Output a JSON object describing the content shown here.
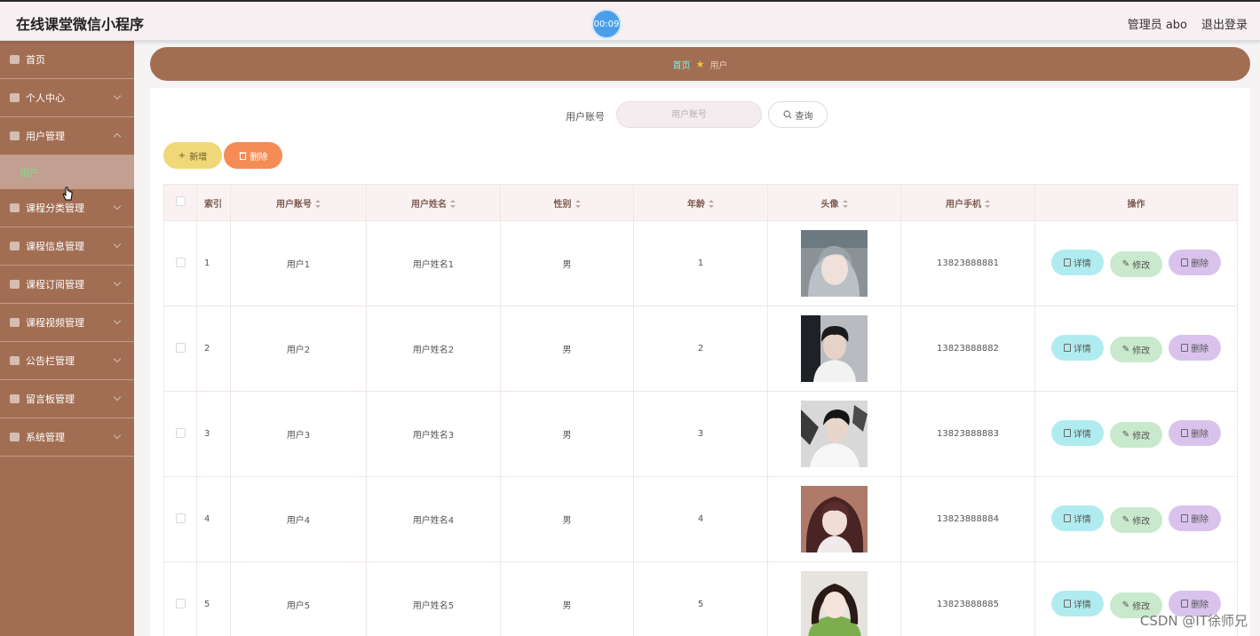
{
  "header": {
    "title": "在线课堂微信小程序",
    "timer": "00:09",
    "admin": "管理员 abo",
    "logout": "退出登录"
  },
  "sidebar": {
    "items": [
      {
        "label": "首页",
        "icon": "home-icon",
        "has_chevron": false
      },
      {
        "label": "个人中心",
        "icon": "user-icon",
        "has_chevron": true
      },
      {
        "label": "用户管理",
        "icon": "list-icon",
        "has_chevron": true,
        "expanded": true
      },
      {
        "label": "课程分类管理",
        "icon": "list-icon",
        "has_chevron": true
      },
      {
        "label": "课程信息管理",
        "icon": "folder-icon",
        "has_chevron": true
      },
      {
        "label": "课程订阅管理",
        "icon": "frame-icon",
        "has_chevron": true
      },
      {
        "label": "课程视频管理",
        "icon": "gear-icon",
        "has_chevron": true
      },
      {
        "label": "公告栏管理",
        "icon": "menu-icon",
        "has_chevron": true
      },
      {
        "label": "留言板管理",
        "icon": "frame-icon",
        "has_chevron": true
      },
      {
        "label": "系统管理",
        "icon": "settings-icon",
        "has_chevron": true
      }
    ],
    "submenu_label": "用户"
  },
  "breadcrumb": {
    "home": "首页",
    "current": "用户"
  },
  "search": {
    "label": "用户账号",
    "placeholder": "用户账号",
    "button": "查询"
  },
  "toolbar": {
    "add": "新增",
    "delete": "删除"
  },
  "table": {
    "headers": [
      "索引",
      "用户账号",
      "用户姓名",
      "性别",
      "年龄",
      "头像",
      "用户手机",
      "操作"
    ],
    "rows": [
      {
        "index": "1",
        "account": "用户1",
        "name": "用户姓名1",
        "gender": "男",
        "age": "1",
        "phone": "13823888881"
      },
      {
        "index": "2",
        "account": "用户2",
        "name": "用户姓名2",
        "gender": "男",
        "age": "2",
        "phone": "13823888882"
      },
      {
        "index": "3",
        "account": "用户3",
        "name": "用户姓名3",
        "gender": "男",
        "age": "3",
        "phone": "13823888883"
      },
      {
        "index": "4",
        "account": "用户4",
        "name": "用户姓名4",
        "gender": "男",
        "age": "4",
        "phone": "13823888884"
      },
      {
        "index": "5",
        "account": "用户5",
        "name": "用户姓名5",
        "gender": "男",
        "age": "5",
        "phone": "13823888885"
      }
    ],
    "actions": {
      "detail": "详情",
      "edit": "修改",
      "remove": "删除"
    }
  },
  "watermark": "CSDN @IT徐师兄"
}
